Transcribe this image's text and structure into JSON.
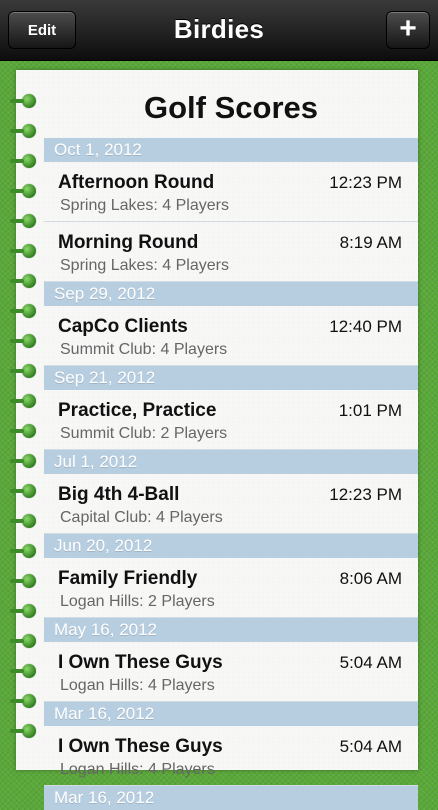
{
  "navbar": {
    "title": "Birdies",
    "edit_label": "Edit",
    "add_label": "+"
  },
  "sheet": {
    "title": "Golf Scores"
  },
  "sections": [
    {
      "date": "Oct 1, 2012",
      "rows": [
        {
          "name": "Afternoon Round",
          "time": "12:23 PM",
          "sub": "Spring Lakes: 4 Players"
        },
        {
          "name": "Morning Round",
          "time": "8:19 AM",
          "sub": "Spring Lakes: 4 Players"
        }
      ]
    },
    {
      "date": "Sep 29, 2012",
      "rows": [
        {
          "name": "CapCo Clients",
          "time": "12:40 PM",
          "sub": "Summit Club: 4 Players"
        }
      ]
    },
    {
      "date": "Sep 21, 2012",
      "rows": [
        {
          "name": "Practice, Practice",
          "time": "1:01 PM",
          "sub": "Summit Club: 2 Players"
        }
      ]
    },
    {
      "date": "Jul 1, 2012",
      "rows": [
        {
          "name": "Big 4th 4-Ball",
          "time": "12:23 PM",
          "sub": "Capital Club: 4 Players"
        }
      ]
    },
    {
      "date": "Jun 20, 2012",
      "rows": [
        {
          "name": "Family Friendly",
          "time": "8:06 AM",
          "sub": "Logan Hills: 2 Players"
        }
      ]
    },
    {
      "date": "May 16, 2012",
      "rows": [
        {
          "name": "I Own These Guys",
          "time": "5:04 AM",
          "sub": "Logan Hills: 4 Players"
        }
      ]
    },
    {
      "date": "Mar 16, 2012",
      "rows": []
    }
  ]
}
